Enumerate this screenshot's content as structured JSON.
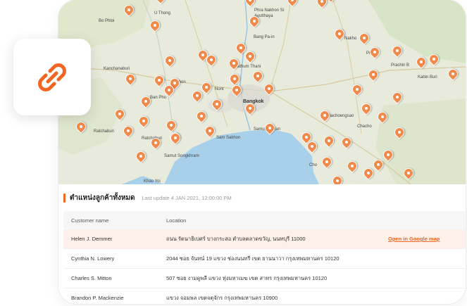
{
  "map": {
    "places": [
      {
        "id": "bophloi",
        "label": "Bo Phloi"
      },
      {
        "id": "uthong",
        "label": "U Thong"
      },
      {
        "id": "phranakhonsi",
        "label": "Phra Nakhon Si"
      },
      {
        "id": "ayutthaya",
        "label": "Ayutthaya"
      },
      {
        "id": "bangpain",
        "label": "Bang Pa-in"
      },
      {
        "id": "nakhonnayok",
        "label": "Nakho"
      },
      {
        "id": "kanchanaburi",
        "label": "Kanchanaburi"
      },
      {
        "id": "prachin",
        "label": "Prachin B"
      },
      {
        "id": "kabinburi",
        "label": "Kabin Buri"
      },
      {
        "id": "pathumthani",
        "label": "Pathum Thani"
      },
      {
        "id": "nonthaburi",
        "label": "Nont"
      },
      {
        "id": "bangkok",
        "label": "Bangkok"
      },
      {
        "id": "bankhon",
        "label": "Ban Pho"
      },
      {
        "id": "khon",
        "label": "Nakhon"
      },
      {
        "id": "chachoengsao",
        "label": "Chachoengsao"
      },
      {
        "id": "chachoen2",
        "label": "Chacho"
      },
      {
        "id": "ratchaburi",
        "label": "Ratchaburi"
      },
      {
        "id": "samutsakhon",
        "label": "Sam Sakhon"
      },
      {
        "id": "samutprakan",
        "label": "Samut Prakan"
      },
      {
        "id": "samutsongkhram",
        "label": "Samut Songkhram"
      },
      {
        "id": "photharam",
        "label": "Ratchaburi"
      },
      {
        "id": "khaoyoi",
        "label": "Khao Yoi"
      },
      {
        "id": "chon",
        "label": "Cho"
      },
      {
        "id": "praprachin",
        "label": "Pra"
      }
    ]
  },
  "panel": {
    "title": "ตำแหน่งลูกค้าทั้งหมด",
    "last_update": "Last update 4 JAN 2021, 12:00:00 PM",
    "columns": {
      "name": "Customer name",
      "location": "Location"
    },
    "rows": [
      {
        "name": "Helen J. Demmer",
        "location": "ถนน รัตนาธิเบศร์ บางกระสอ ตำบลตลาดขวัญ, นนทบุรี 11000",
        "action": "Open in Google map"
      },
      {
        "name": "Cynthia N. Lowery",
        "location": "2044 ซอย จันทน์ 19 แขวง ช่องนนทรี เขต ยานนาวา กรุงเทพมหานคร 10120",
        "action": ""
      },
      {
        "name": "Charles S. Mitton",
        "location": "507 ซอย งามดูพลี แขวง ทุ่งมหาเมฆ เขต สาทร กรุงเทพมหานคร 10120",
        "action": ""
      },
      {
        "name": "Brandon P. Mackenzie",
        "location": "แขวง จอมพล เขตจตุจักร กรุงเทพมหานคร 10900",
        "action": ""
      }
    ]
  },
  "colors": {
    "accent": "#f26522",
    "pin": "#f08a4b",
    "water": "#a8d0ea",
    "row_highlight": "#fdf0e9"
  },
  "logo": {
    "icon": "chain-link-icon"
  }
}
